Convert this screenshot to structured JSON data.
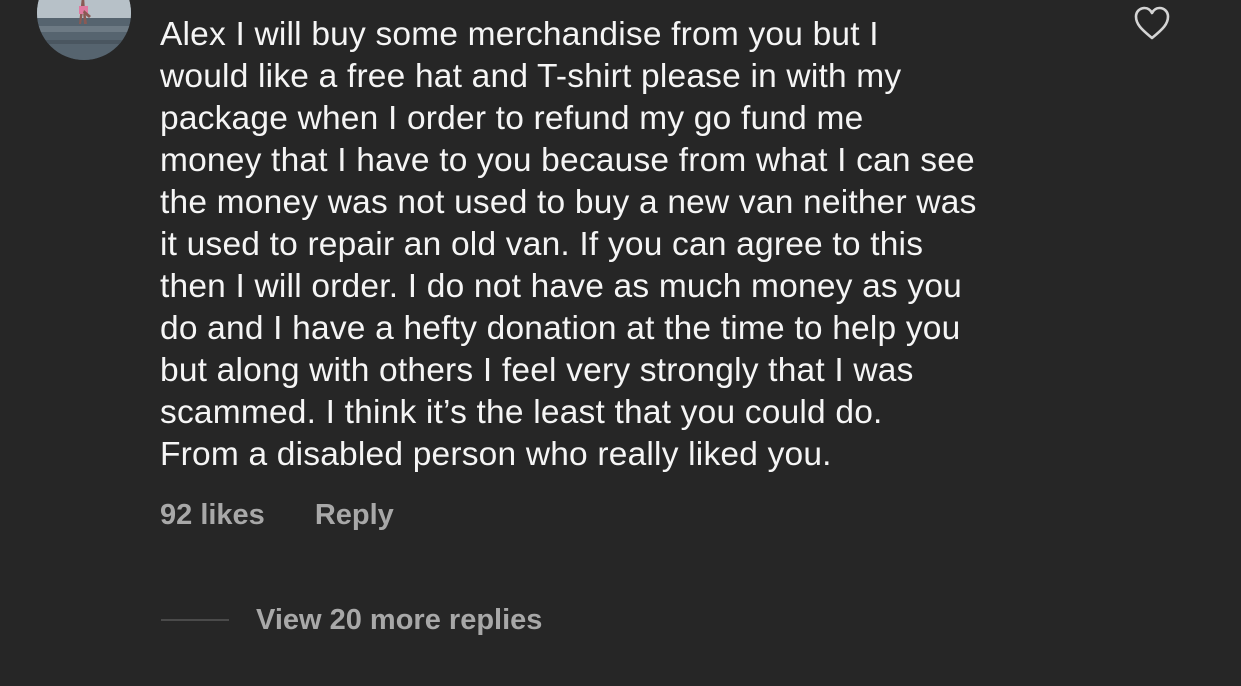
{
  "comment": {
    "text": "Alex I will buy some merchandise from you but I\nwould like a free hat and T-shirt please in with my\npackage when I order to refund my go fund me\nmoney that I have to you because from what I can see\nthe money was not used to buy a new van neither was\nit used to repair an old van.  If you can agree to this\nthen I will order.  I do not have as much money as you\ndo and I have a hefty donation at the time to help you\nbut along with others I feel very strongly that I was\nscammed.  I think it’s the least that you could do.\nFrom a disabled person who really liked you.",
    "likes": "92 likes",
    "reply_label": "Reply",
    "view_replies_label": "View 20 more replies"
  },
  "icons": {
    "like": "heart-outline-icon",
    "avatar": "profile-photo"
  },
  "colors": {
    "background": "#262626",
    "text": "#f5f5f5",
    "muted": "#a8a8a8"
  }
}
